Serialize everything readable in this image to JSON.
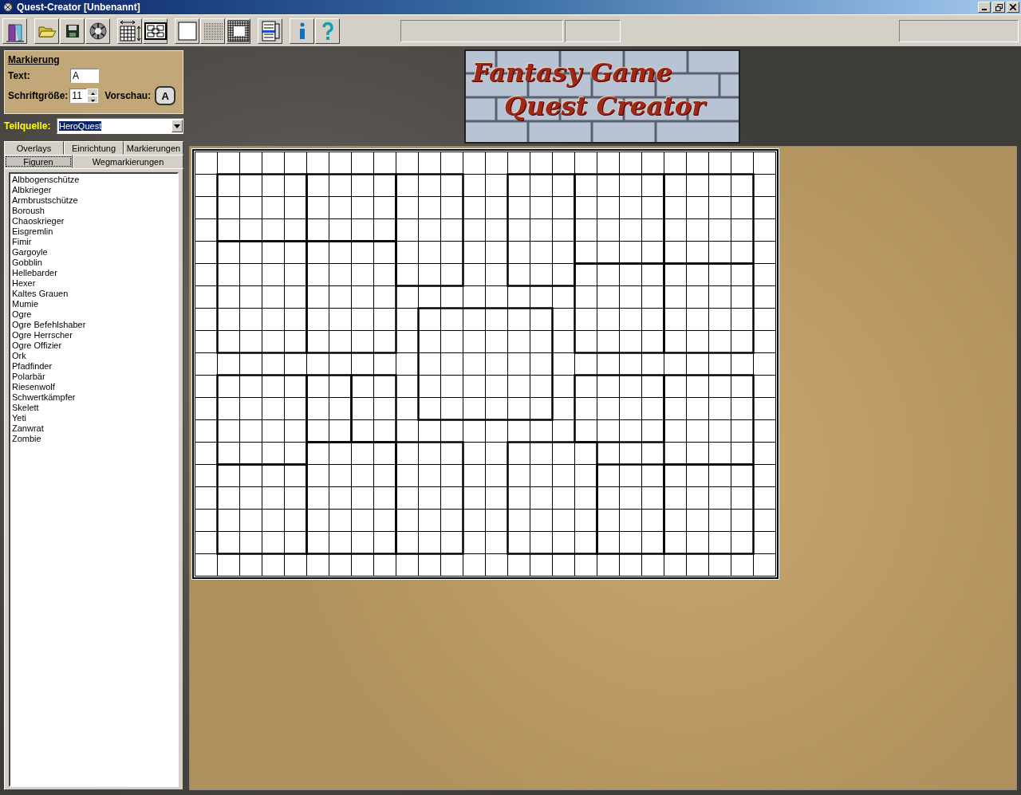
{
  "window": {
    "title": "Quest-Creator [Unbenannt]"
  },
  "logo": {
    "lines": [
      "Fantasy Game",
      "Quest Creator"
    ]
  },
  "marking_panel": {
    "title": "Markierung",
    "text_label": "Text:",
    "text_value": "A",
    "size_label": "Schriftgröße:",
    "size_value": "11",
    "preview_label": "Vorschau:",
    "preview_text": "A"
  },
  "source": {
    "label": "Teilquelle:",
    "value": "HeroQuest"
  },
  "tab_rows": [
    [
      {
        "label": "Overlays",
        "selected": false
      },
      {
        "label": "Einrichtung",
        "selected": false
      },
      {
        "label": "Markierungen",
        "selected": false
      }
    ],
    [
      {
        "label": "Figuren",
        "selected": true
      },
      {
        "label": "Wegmarkierungen",
        "selected": false
      }
    ]
  ],
  "figures": [
    "Albbogenschütze",
    "Albkrieger",
    "Armbrustschütze",
    "Boroush",
    "Chaoskrieger",
    "Eisgremlin",
    "Fimir",
    "Gargoyle",
    "Gobblin",
    "Hellebarder",
    "Hexer",
    "Kaltes Grauen",
    "Mumie",
    "Ogre",
    "Ogre Befehlshaber",
    "Ogre Herrscher",
    "Ogre Offizier",
    "Ork",
    "Pfadfinder",
    "Polarbär",
    "Riesenwolf",
    "Schwertkämpfer",
    "Skelett",
    "Yeti",
    "Zanwrat",
    "Zombie"
  ]
}
